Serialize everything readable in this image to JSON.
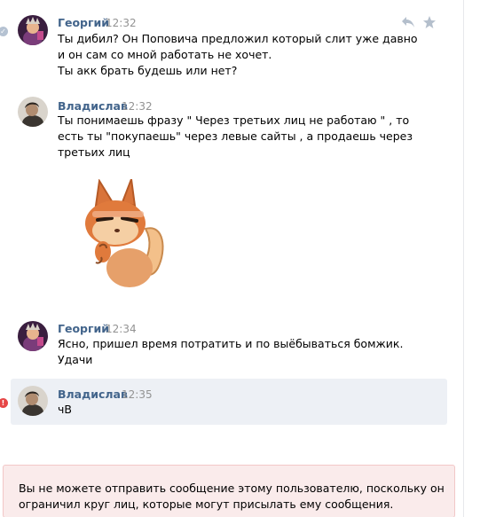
{
  "messages": [
    {
      "author": "Георгий",
      "time": "12:32",
      "lines": [
        "Ты дибил? Он Поповича предложил который слит уже давно",
        "и он сам со мной работать не хочет.",
        "Ты акк брать будешь или нет?"
      ]
    },
    {
      "author": "Владислав",
      "time": "12:32",
      "lines": [
        "Ты понимаешь фразу \" Через третьих лиц не работаю \" , то",
        "есть ты \"покупаешь\" через левые сайты , а продаешь через",
        "третьих лиц"
      ],
      "sticker": "squirrel-thinking-sticker"
    },
    {
      "author": "Георгий",
      "time": "12:34",
      "lines": [
        "Ясно, пришел время потратить и по выёбываться бомжик.",
        "Удачи"
      ]
    },
    {
      "author": "Владислав",
      "time": "12:35",
      "lines": [
        "чВ"
      ]
    }
  ],
  "notice": {
    "lines": [
      "Вы не можете отправить сообщение этому пользователю, поскольку он",
      "ограничил круг лиц, которые могут присылать ему сообщения."
    ]
  },
  "icons": {
    "reply": "reply-icon",
    "favorite": "star-icon",
    "read_status": "check-circle-icon",
    "error_status": "error-icon"
  },
  "colors": {
    "author": "#42648b",
    "time": "#939393",
    "highlight_bg": "#edf0f5",
    "notice_bg": "#faebeb",
    "error": "#e64646"
  }
}
